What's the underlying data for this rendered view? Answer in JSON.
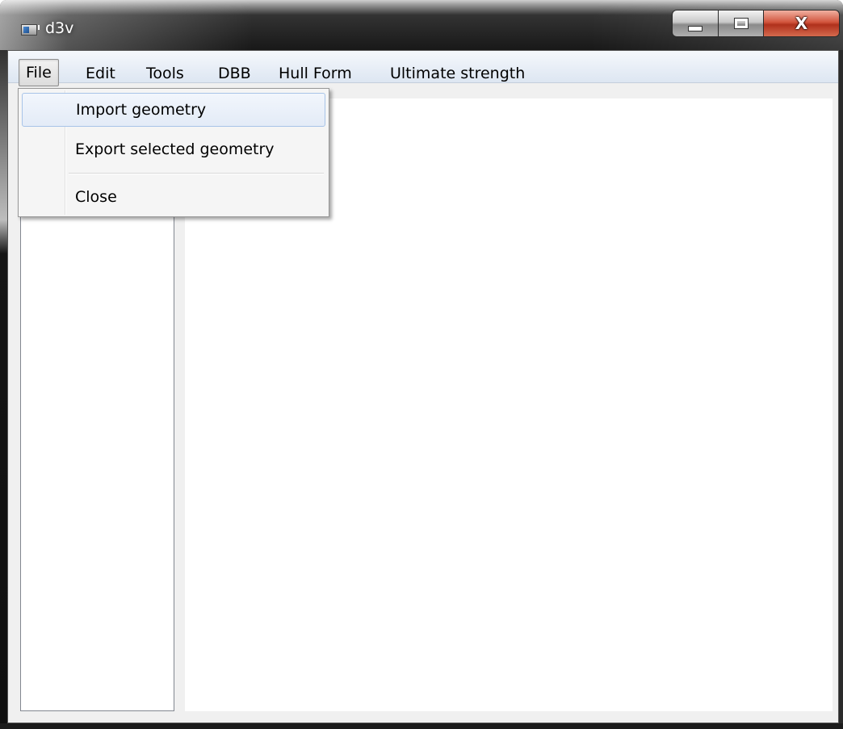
{
  "window": {
    "title": "d3v",
    "icon": "app-window-icon",
    "caption_buttons": {
      "minimize": "minimize-icon",
      "maximize": "maximize-icon",
      "close_label": "X"
    }
  },
  "menubar": {
    "items": [
      {
        "label": "File",
        "active": true
      },
      {
        "label": "Edit"
      },
      {
        "label": "Tools"
      },
      {
        "label": "DBB"
      },
      {
        "label": "Hull Form"
      },
      {
        "label": "Ultimate strength"
      }
    ]
  },
  "file_menu": {
    "items": [
      {
        "label": "Import geometry",
        "highlighted": true
      },
      {
        "label": "Export selected geometry"
      },
      {
        "label": "Close"
      }
    ]
  }
}
